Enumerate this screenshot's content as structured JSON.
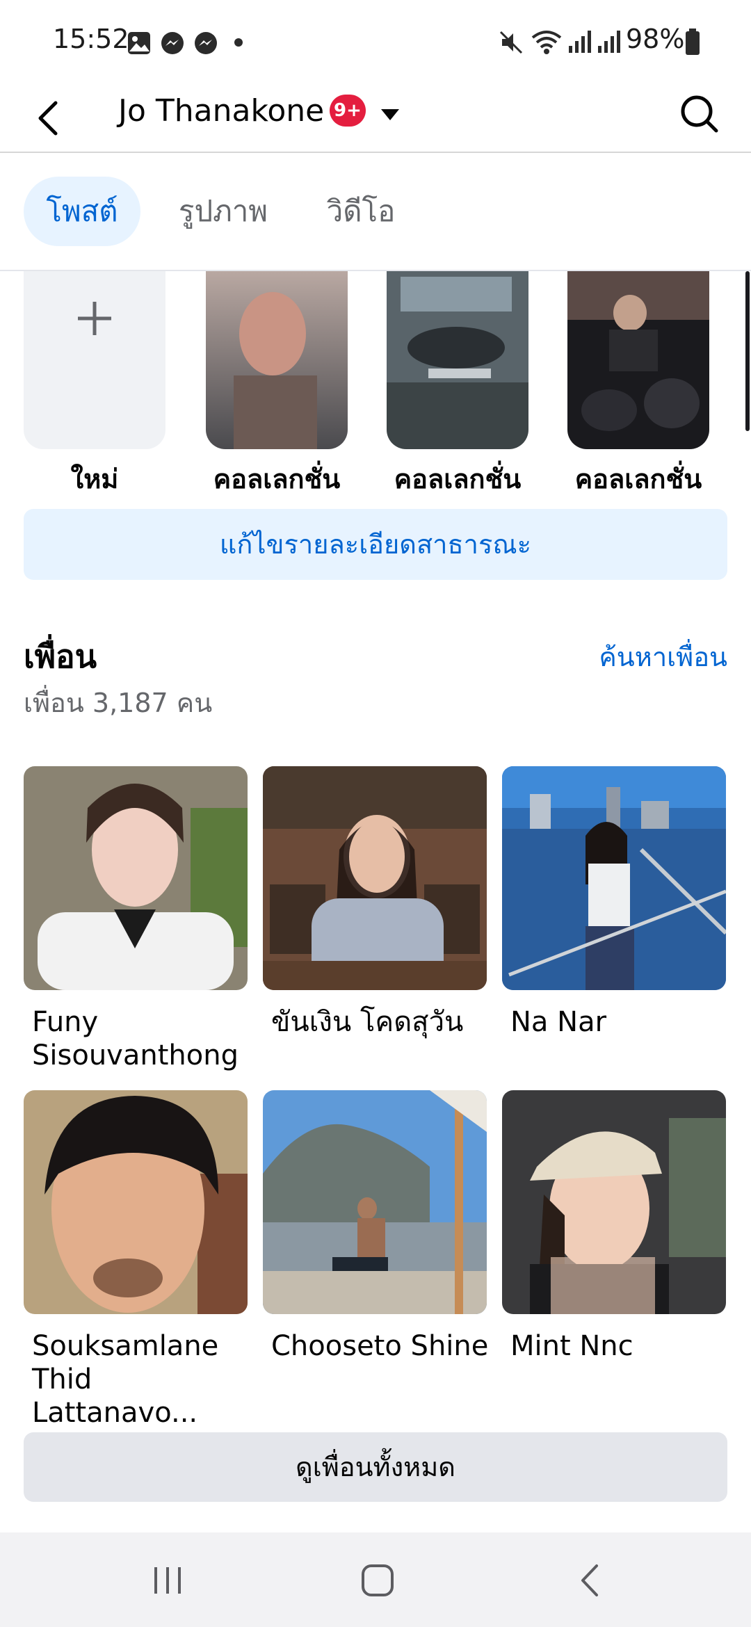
{
  "status_bar": {
    "time": "15:52",
    "battery": "98%",
    "left_icons": [
      "gallery-icon",
      "messenger-icon",
      "messenger-icon",
      "dot-icon"
    ],
    "right_icons": [
      "mute-icon",
      "wifi-icon",
      "signal-icon",
      "signal-icon",
      "battery-icon"
    ]
  },
  "header": {
    "title": "Jo Thanakone",
    "badge": "9+"
  },
  "tabs": [
    {
      "label": "โพสต์",
      "active": true
    },
    {
      "label": "รูปภาพ",
      "active": false
    },
    {
      "label": "วิดีโอ",
      "active": false
    }
  ],
  "collections": {
    "new_label": "ใหม่",
    "items": [
      {
        "label": "คอลเลกชั่น"
      },
      {
        "label": "คอลเลกชั่น"
      },
      {
        "label": "คอลเลกชั่น"
      }
    ]
  },
  "edit_details_label": "แก้ไขรายละเอียดสาธารณะ",
  "friends": {
    "title": "เพื่อน",
    "find_label": "ค้นหาเพื่อน",
    "count_text": "เพื่อน 3,187 คน",
    "items": [
      {
        "name_line1": "Funy",
        "name_line2": "Sisouvanthong"
      },
      {
        "name_line1": "ขันเงิน โคดสุวัน",
        "name_line2": ""
      },
      {
        "name_line1": "Na Nar",
        "name_line2": ""
      },
      {
        "name_line1": "Souksamlane",
        "name_line2": "Thid Lattanavo..."
      },
      {
        "name_line1": "Chooseto Shine",
        "name_line2": ""
      },
      {
        "name_line1": "Mint Nnc",
        "name_line2": ""
      }
    ],
    "see_all_label": "ดูเพื่อนทั้งหมด"
  },
  "colors": {
    "accent": "#0064d1",
    "accent_bg": "#e7f3ff",
    "badge": "#e41e3f",
    "secondary_text": "#65676b"
  }
}
